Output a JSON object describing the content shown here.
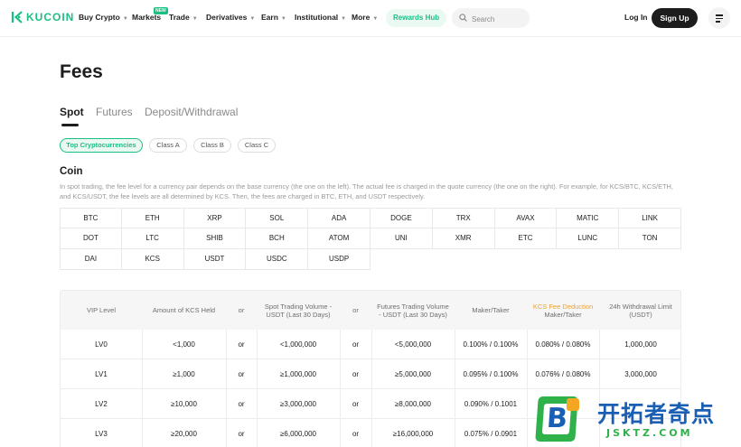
{
  "brand": {
    "name": "KUCOIN",
    "accent": "#1bbf83"
  },
  "nav": {
    "items": [
      "Buy Crypto",
      "Markets",
      "Trade",
      "Derivatives",
      "Earn",
      "Institutional",
      "More"
    ],
    "new_badge": "NEW",
    "rewards": "Rewards Hub",
    "search_placeholder": "Search",
    "login": "Log In",
    "signup": "Sign Up"
  },
  "page": {
    "title": "Fees"
  },
  "tabs": [
    "Spot",
    "Futures",
    "Deposit/Withdrawal"
  ],
  "active_tab": "Spot",
  "classes": [
    "Top Cryptocurrencies",
    "Class A",
    "Class B",
    "Class C"
  ],
  "active_class": "Top Cryptocurrencies",
  "coin_section": {
    "title": "Coin",
    "description": "In spot trading, the fee level for a currency pair depends on the base currency (the one on the left). The actual fee is charged in the quote currency (the one on the right). For example, for KCS/BTC, KCS/ETH, and KCS/USDT, the fee levels are all determined by KCS. Then, the fees are charged in BTC, ETH, and USDT respectively.",
    "coins": [
      "BTC",
      "ETH",
      "XRP",
      "SOL",
      "ADA",
      "DOGE",
      "TRX",
      "AVAX",
      "MATIC",
      "LINK",
      "DOT",
      "LTC",
      "SHIB",
      "BCH",
      "ATOM",
      "UNI",
      "XMR",
      "ETC",
      "LUNC",
      "TON",
      "DAI",
      "KCS",
      "USDT",
      "USDC",
      "USDP"
    ]
  },
  "fee_table": {
    "headers": {
      "vip": "VIP Level",
      "kcs": "Amount of KCS Held",
      "or1": "or",
      "spot": "Spot Trading Volume - USDT (Last 30 Days)",
      "or2": "or",
      "futures": "Futures Trading Volume - USDT (Last 30 Days)",
      "maker_taker": "Maker/Taker",
      "kcs_fee_1": "KCS Fee Deduction",
      "kcs_fee_2": "Maker/Taker",
      "withdrawal": "24h Withdrawal Limit (USDT)"
    },
    "rows": [
      {
        "level": "LV0",
        "kcs": "<1,000",
        "or1": "or",
        "spot": "<1,000,000",
        "or2": "or",
        "futures": "<5,000,000",
        "maker_taker": "0.100% / 0.100%",
        "kcs_deduct": "0.080% / 0.080%",
        "withdrawal": "1,000,000"
      },
      {
        "level": "LV1",
        "kcs": "≥1,000",
        "or1": "or",
        "spot": "≥1,000,000",
        "or2": "or",
        "futures": "≥5,000,000",
        "maker_taker": "0.095% / 0.100%",
        "kcs_deduct": "0.076% / 0.080%",
        "withdrawal": "3,000,000"
      },
      {
        "level": "LV2",
        "kcs": "≥10,000",
        "or1": "or",
        "spot": "≥3,000,000",
        "or2": "or",
        "futures": "≥8,000,000",
        "maker_taker": "0.090% / 0.1001",
        "kcs_deduct": "",
        "withdrawal": ""
      },
      {
        "level": "LV3",
        "kcs": "≥20,000",
        "or1": "or",
        "spot": "≥6,000,000",
        "or2": "or",
        "futures": "≥16,000,000",
        "maker_taker": "0.075% / 0.0901",
        "kcs_deduct": "",
        "withdrawal": ""
      }
    ]
  },
  "watermark": {
    "letter": "B",
    "cn": "开拓者奇点",
    "en": "JSKTZ.COM"
  }
}
